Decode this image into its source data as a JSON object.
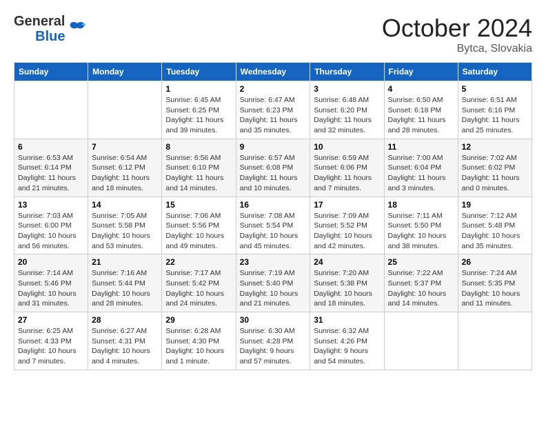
{
  "header": {
    "logo_line1": "General",
    "logo_line2": "Blue",
    "month": "October 2024",
    "location": "Bytca, Slovakia"
  },
  "weekdays": [
    "Sunday",
    "Monday",
    "Tuesday",
    "Wednesday",
    "Thursday",
    "Friday",
    "Saturday"
  ],
  "weeks": [
    [
      {
        "day": "",
        "sunrise": "",
        "sunset": "",
        "daylight": ""
      },
      {
        "day": "",
        "sunrise": "",
        "sunset": "",
        "daylight": ""
      },
      {
        "day": "1",
        "sunrise": "Sunrise: 6:45 AM",
        "sunset": "Sunset: 6:25 PM",
        "daylight": "Daylight: 11 hours and 39 minutes."
      },
      {
        "day": "2",
        "sunrise": "Sunrise: 6:47 AM",
        "sunset": "Sunset: 6:23 PM",
        "daylight": "Daylight: 11 hours and 35 minutes."
      },
      {
        "day": "3",
        "sunrise": "Sunrise: 6:48 AM",
        "sunset": "Sunset: 6:20 PM",
        "daylight": "Daylight: 11 hours and 32 minutes."
      },
      {
        "day": "4",
        "sunrise": "Sunrise: 6:50 AM",
        "sunset": "Sunset: 6:18 PM",
        "daylight": "Daylight: 11 hours and 28 minutes."
      },
      {
        "day": "5",
        "sunrise": "Sunrise: 6:51 AM",
        "sunset": "Sunset: 6:16 PM",
        "daylight": "Daylight: 11 hours and 25 minutes."
      }
    ],
    [
      {
        "day": "6",
        "sunrise": "Sunrise: 6:53 AM",
        "sunset": "Sunset: 6:14 PM",
        "daylight": "Daylight: 11 hours and 21 minutes."
      },
      {
        "day": "7",
        "sunrise": "Sunrise: 6:54 AM",
        "sunset": "Sunset: 6:12 PM",
        "daylight": "Daylight: 11 hours and 18 minutes."
      },
      {
        "day": "8",
        "sunrise": "Sunrise: 6:56 AM",
        "sunset": "Sunset: 6:10 PM",
        "daylight": "Daylight: 11 hours and 14 minutes."
      },
      {
        "day": "9",
        "sunrise": "Sunrise: 6:57 AM",
        "sunset": "Sunset: 6:08 PM",
        "daylight": "Daylight: 11 hours and 10 minutes."
      },
      {
        "day": "10",
        "sunrise": "Sunrise: 6:59 AM",
        "sunset": "Sunset: 6:06 PM",
        "daylight": "Daylight: 11 hours and 7 minutes."
      },
      {
        "day": "11",
        "sunrise": "Sunrise: 7:00 AM",
        "sunset": "Sunset: 6:04 PM",
        "daylight": "Daylight: 11 hours and 3 minutes."
      },
      {
        "day": "12",
        "sunrise": "Sunrise: 7:02 AM",
        "sunset": "Sunset: 6:02 PM",
        "daylight": "Daylight: 11 hours and 0 minutes."
      }
    ],
    [
      {
        "day": "13",
        "sunrise": "Sunrise: 7:03 AM",
        "sunset": "Sunset: 6:00 PM",
        "daylight": "Daylight: 10 hours and 56 minutes."
      },
      {
        "day": "14",
        "sunrise": "Sunrise: 7:05 AM",
        "sunset": "Sunset: 5:58 PM",
        "daylight": "Daylight: 10 hours and 53 minutes."
      },
      {
        "day": "15",
        "sunrise": "Sunrise: 7:06 AM",
        "sunset": "Sunset: 5:56 PM",
        "daylight": "Daylight: 10 hours and 49 minutes."
      },
      {
        "day": "16",
        "sunrise": "Sunrise: 7:08 AM",
        "sunset": "Sunset: 5:54 PM",
        "daylight": "Daylight: 10 hours and 45 minutes."
      },
      {
        "day": "17",
        "sunrise": "Sunrise: 7:09 AM",
        "sunset": "Sunset: 5:52 PM",
        "daylight": "Daylight: 10 hours and 42 minutes."
      },
      {
        "day": "18",
        "sunrise": "Sunrise: 7:11 AM",
        "sunset": "Sunset: 5:50 PM",
        "daylight": "Daylight: 10 hours and 38 minutes."
      },
      {
        "day": "19",
        "sunrise": "Sunrise: 7:12 AM",
        "sunset": "Sunset: 5:48 PM",
        "daylight": "Daylight: 10 hours and 35 minutes."
      }
    ],
    [
      {
        "day": "20",
        "sunrise": "Sunrise: 7:14 AM",
        "sunset": "Sunset: 5:46 PM",
        "daylight": "Daylight: 10 hours and 31 minutes."
      },
      {
        "day": "21",
        "sunrise": "Sunrise: 7:16 AM",
        "sunset": "Sunset: 5:44 PM",
        "daylight": "Daylight: 10 hours and 28 minutes."
      },
      {
        "day": "22",
        "sunrise": "Sunrise: 7:17 AM",
        "sunset": "Sunset: 5:42 PM",
        "daylight": "Daylight: 10 hours and 24 minutes."
      },
      {
        "day": "23",
        "sunrise": "Sunrise: 7:19 AM",
        "sunset": "Sunset: 5:40 PM",
        "daylight": "Daylight: 10 hours and 21 minutes."
      },
      {
        "day": "24",
        "sunrise": "Sunrise: 7:20 AM",
        "sunset": "Sunset: 5:38 PM",
        "daylight": "Daylight: 10 hours and 18 minutes."
      },
      {
        "day": "25",
        "sunrise": "Sunrise: 7:22 AM",
        "sunset": "Sunset: 5:37 PM",
        "daylight": "Daylight: 10 hours and 14 minutes."
      },
      {
        "day": "26",
        "sunrise": "Sunrise: 7:24 AM",
        "sunset": "Sunset: 5:35 PM",
        "daylight": "Daylight: 10 hours and 11 minutes."
      }
    ],
    [
      {
        "day": "27",
        "sunrise": "Sunrise: 6:25 AM",
        "sunset": "Sunset: 4:33 PM",
        "daylight": "Daylight: 10 hours and 7 minutes."
      },
      {
        "day": "28",
        "sunrise": "Sunrise: 6:27 AM",
        "sunset": "Sunset: 4:31 PM",
        "daylight": "Daylight: 10 hours and 4 minutes."
      },
      {
        "day": "29",
        "sunrise": "Sunrise: 6:28 AM",
        "sunset": "Sunset: 4:30 PM",
        "daylight": "Daylight: 10 hours and 1 minute."
      },
      {
        "day": "30",
        "sunrise": "Sunrise: 6:30 AM",
        "sunset": "Sunset: 4:28 PM",
        "daylight": "Daylight: 9 hours and 57 minutes."
      },
      {
        "day": "31",
        "sunrise": "Sunrise: 6:32 AM",
        "sunset": "Sunset: 4:26 PM",
        "daylight": "Daylight: 9 hours and 54 minutes."
      },
      {
        "day": "",
        "sunrise": "",
        "sunset": "",
        "daylight": ""
      },
      {
        "day": "",
        "sunrise": "",
        "sunset": "",
        "daylight": ""
      }
    ]
  ]
}
